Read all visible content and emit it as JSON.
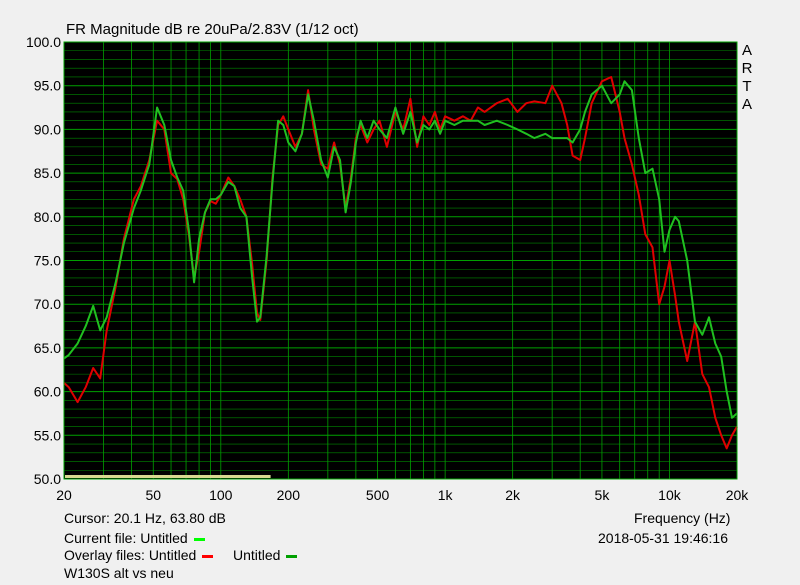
{
  "title": "FR Magnitude dB re 20uPa/2.83V (1/12 oct)",
  "brand_letters": [
    "A",
    "R",
    "T",
    "A"
  ],
  "cursor_readout": "Cursor: 20.1 Hz, 63.80 dB",
  "current_file": {
    "label": "Current file: Untitled",
    "color": "#00ff00"
  },
  "overlay_files": {
    "prefix": "Overlay files: ",
    "items": [
      {
        "name": "Untitled",
        "color": "#ff0000"
      },
      {
        "name": "Untitled",
        "color": "#00a000"
      }
    ]
  },
  "description": "W130S alt vs neu",
  "timestamp": "2018-05-31  19:46:16",
  "colors": {
    "plot_background": "#000000",
    "grid": "#00a000",
    "cursor_bar": "#d8d890"
  },
  "chart_data": {
    "type": "line",
    "title": "FR Magnitude dB re 20uPa/2.83V (1/12 oct)",
    "xlabel": "Frequency (Hz)",
    "ylabel": "",
    "xscale": "log",
    "xlim": [
      20,
      20000
    ],
    "ylim": [
      50,
      100
    ],
    "grid": true,
    "x_ticks": [
      20,
      50,
      100,
      200,
      500,
      1000,
      2000,
      5000,
      10000,
      20000
    ],
    "x_tick_labels": [
      "20",
      "50",
      "100",
      "200",
      "500",
      "1k",
      "2k",
      "5k",
      "10k",
      "20k"
    ],
    "y_ticks": [
      50,
      55,
      60,
      65,
      70,
      75,
      80,
      85,
      90,
      95,
      100
    ],
    "y_tick_labels": [
      "50.0",
      "55.0",
      "60.0",
      "65.0",
      "70.0",
      "75.0",
      "80.0",
      "85.0",
      "90.0",
      "95.0",
      "100.0"
    ],
    "series": [
      {
        "color": "#e00000",
        "x": [
          20,
          21,
          23,
          25,
          27,
          29,
          31,
          34,
          37,
          41,
          44,
          48,
          52,
          56,
          60,
          64,
          68,
          72,
          76,
          80,
          85,
          90,
          95,
          100,
          108,
          115,
          122,
          130,
          138,
          145,
          150,
          160,
          170,
          180,
          190,
          200,
          215,
          230,
          245,
          260,
          280,
          300,
          320,
          340,
          360,
          380,
          400,
          420,
          450,
          480,
          510,
          550,
          600,
          650,
          700,
          750,
          800,
          850,
          900,
          950,
          1000,
          1100,
          1200,
          1300,
          1400,
          1500,
          1700,
          1900,
          2100,
          2300,
          2500,
          2800,
          3000,
          3300,
          3500,
          3700,
          4000,
          4200,
          4500,
          5000,
          5500,
          6000,
          6300,
          6800,
          7300,
          7800,
          8400,
          9000,
          9500,
          10000,
          10600,
          11000,
          12000,
          13000,
          14000,
          15000,
          16000,
          17000,
          18000,
          19000,
          20000
        ],
        "y": [
          61.0,
          60.5,
          58.8,
          60.5,
          62.7,
          61.5,
          67.0,
          72.0,
          77.5,
          82.0,
          83.5,
          86.5,
          91.0,
          90.0,
          85.0,
          84.3,
          82.0,
          78.0,
          73.0,
          76.0,
          80.5,
          81.8,
          81.5,
          82.5,
          84.5,
          83.5,
          82.0,
          80.0,
          74.5,
          69.0,
          68.2,
          75.0,
          84.5,
          90.5,
          91.5,
          90.0,
          88.0,
          89.5,
          94.5,
          90.0,
          86.0,
          85.5,
          88.5,
          86.0,
          81.0,
          84.5,
          89.0,
          90.5,
          88.5,
          90.0,
          91.0,
          88.0,
          92.0,
          90.0,
          93.5,
          88.0,
          91.5,
          90.5,
          92.0,
          90.0,
          91.5,
          91.0,
          91.5,
          91.0,
          92.5,
          92.0,
          93.0,
          93.5,
          92.0,
          93.0,
          93.2,
          93.0,
          95.0,
          93.0,
          90.5,
          87.0,
          86.5,
          89.0,
          93.0,
          95.5,
          96.0,
          92.0,
          89.0,
          86.0,
          82.5,
          78.0,
          76.5,
          70.0,
          72.0,
          75.0,
          71.0,
          68.0,
          63.5,
          68.0,
          62.0,
          60.5,
          57.0,
          55.0,
          53.5,
          55.0,
          56.0
        ]
      },
      {
        "color": "#20c020",
        "x": [
          20,
          21,
          23,
          25,
          27,
          29,
          31,
          34,
          37,
          41,
          44,
          48,
          52,
          56,
          60,
          64,
          68,
          72,
          76,
          80,
          85,
          90,
          95,
          100,
          108,
          115,
          122,
          130,
          138,
          145,
          150,
          160,
          170,
          180,
          190,
          200,
          215,
          230,
          245,
          260,
          280,
          300,
          320,
          340,
          360,
          380,
          400,
          420,
          450,
          480,
          510,
          550,
          600,
          650,
          700,
          750,
          800,
          850,
          900,
          950,
          1000,
          1100,
          1200,
          1300,
          1400,
          1500,
          1700,
          1900,
          2100,
          2300,
          2500,
          2800,
          3000,
          3300,
          3500,
          3700,
          4000,
          4200,
          4500,
          5000,
          5500,
          6000,
          6300,
          6800,
          7300,
          7800,
          8400,
          9000,
          9500,
          10000,
          10600,
          11000,
          12000,
          13000,
          14000,
          15000,
          16000,
          17000,
          18000,
          19000,
          20000
        ],
        "y": [
          63.8,
          64.2,
          65.5,
          67.5,
          69.8,
          67.0,
          68.5,
          72.5,
          77.0,
          81.0,
          83.0,
          86.0,
          92.5,
          90.5,
          86.5,
          84.5,
          83.0,
          78.5,
          72.5,
          77.5,
          80.5,
          82.0,
          82.0,
          82.5,
          84.0,
          83.5,
          81.0,
          80.0,
          73.0,
          68.0,
          68.5,
          75.5,
          84.0,
          91.0,
          90.5,
          88.5,
          87.5,
          89.5,
          94.0,
          91.0,
          86.5,
          84.5,
          88.0,
          86.5,
          80.5,
          84.0,
          88.5,
          91.0,
          89.0,
          91.0,
          90.0,
          89.0,
          92.5,
          89.5,
          92.0,
          88.5,
          90.5,
          90.0,
          91.0,
          89.5,
          91.0,
          90.5,
          91.0,
          91.0,
          91.0,
          90.5,
          91.0,
          90.5,
          90.0,
          89.5,
          89.0,
          89.5,
          89.0,
          89.0,
          89.0,
          88.5,
          90.0,
          92.0,
          94.0,
          95.0,
          93.0,
          94.0,
          95.5,
          94.5,
          89.0,
          85.0,
          85.5,
          82.0,
          76.0,
          78.5,
          80.0,
          79.5,
          75.0,
          68.0,
          66.5,
          68.5,
          65.5,
          64.0,
          60.0,
          57.0,
          57.5
        ]
      }
    ],
    "cursor_marker": {
      "x_range": [
        20,
        165
      ],
      "y": 50
    }
  }
}
